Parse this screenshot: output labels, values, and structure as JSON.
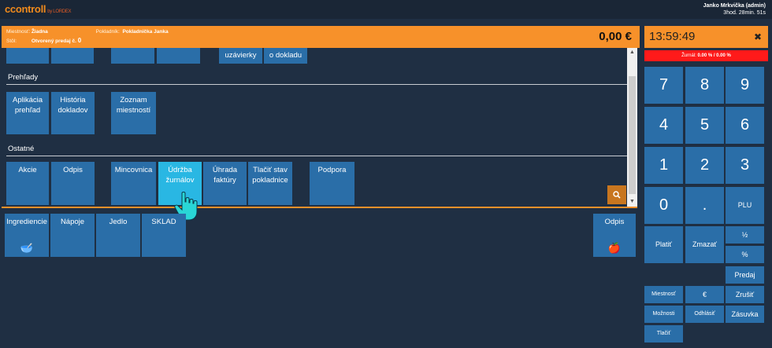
{
  "brand": {
    "logo": "ccontroll",
    "sub": "by LORDEX"
  },
  "user": {
    "name": "Janko Mrkvička (admin)",
    "session": "3hod. 28min. 51s"
  },
  "info": {
    "miestnost_label": "Miestnosť:",
    "miestnost_value": "Žiadna",
    "pokladnik_label": "Pokladník:",
    "pokladnik_value": "Pokladnička Janka",
    "stol_label": "Stôl:",
    "stol_value": "Otvorený predaj č.",
    "stol_num": "0",
    "total": "0,00 €"
  },
  "top_tiles": [
    "",
    "",
    "",
    "",
    "uzávierky",
    "o dokladu"
  ],
  "sections": {
    "prehlady": "Prehľady",
    "ostatne": "Ostatné"
  },
  "prehlady_tiles": [
    "Aplikácia prehľad",
    "História dokladov",
    "Zoznam miestností"
  ],
  "ostatne_tiles": [
    "Akcie",
    "Odpis",
    "Mincovnica",
    "Údržba žurnálov",
    "Úhrada faktúry",
    "Tlačiť stav pokladnice",
    "Podpora"
  ],
  "categories": [
    "Ingrediencie",
    "Nápoje",
    "Jedlo",
    "SKLAD",
    "Odpis"
  ],
  "clock": "13:59:49",
  "zurnal": {
    "label": "Žurnál:",
    "value": "0.00 % / 0.00 %"
  },
  "keypad": [
    "7",
    "8",
    "9",
    "4",
    "5",
    "6",
    "1",
    "2",
    "3",
    "0",
    ".",
    "PLU"
  ],
  "actions": {
    "platit": "Platiť",
    "zmazat": "Zmazať",
    "half": "½",
    "percent": "%",
    "predaj": "Predaj",
    "miestnost": "Miestnosť",
    "euro": "€",
    "zrusit": "Zrušiť",
    "moznosti": "Možnosti",
    "odhlasit": "Odhlásiť",
    "zasuvka": "Zásuvka",
    "tlacit": "Tlačiť"
  },
  "colors": {
    "accent": "#f7912a",
    "tile": "#2a6ea8",
    "active": "#29b7e3",
    "bg": "#1f2f43",
    "alert": "#ff1a1a"
  }
}
